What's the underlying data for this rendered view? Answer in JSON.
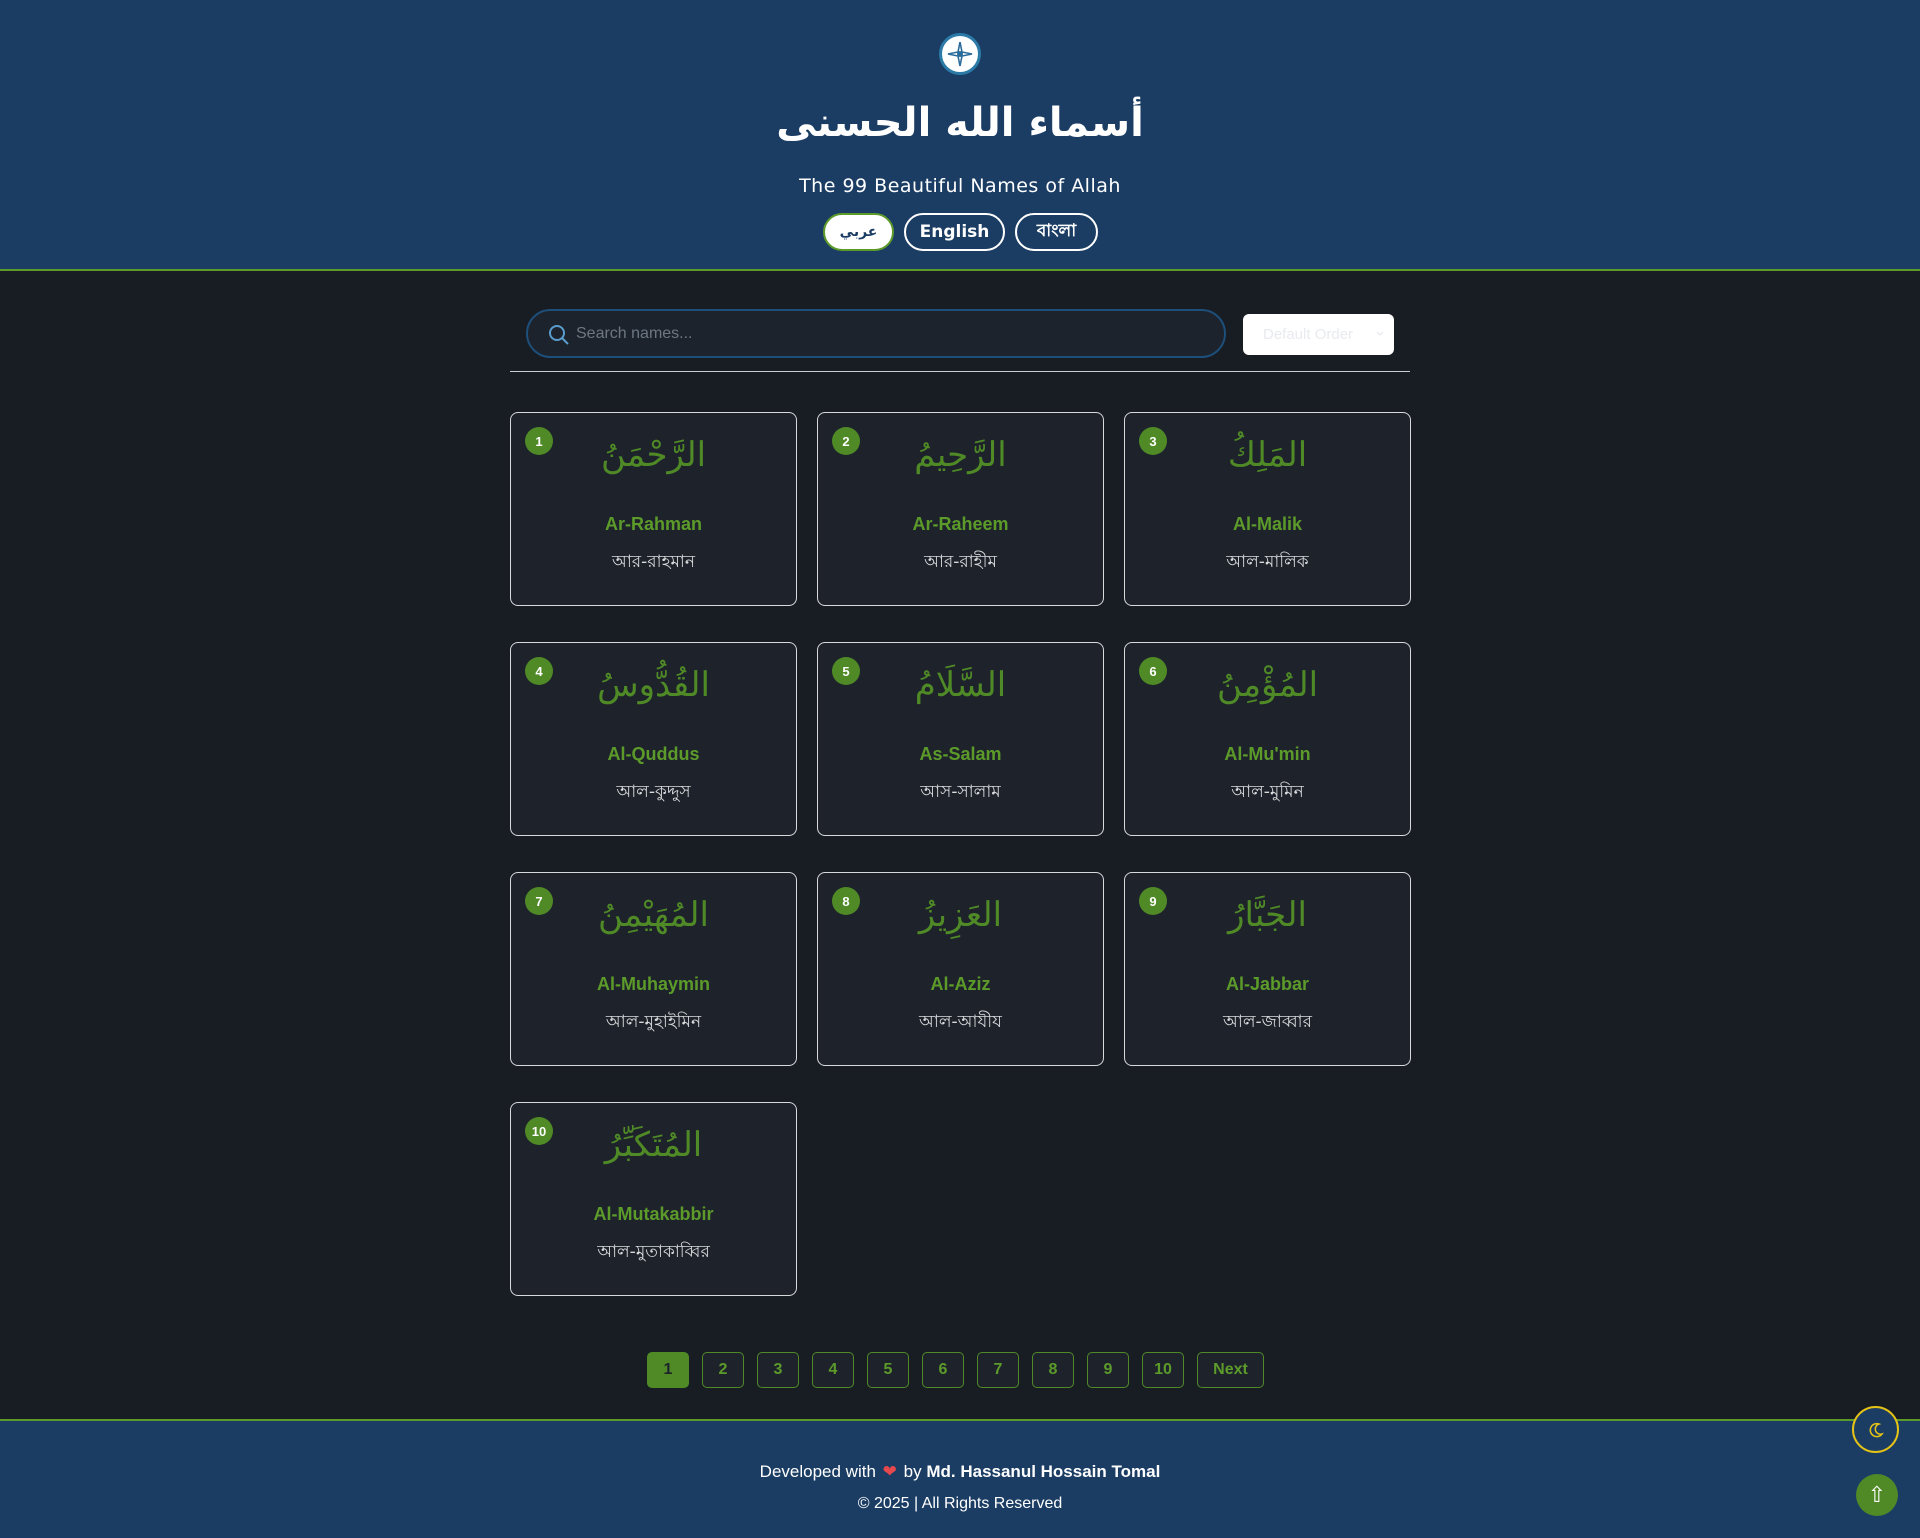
{
  "header": {
    "logo_icon": "compass-icon",
    "title": "أسماء الله الحسنى",
    "subtitle": "The 99 Beautiful Names of Allah",
    "languages": [
      {
        "label": "عربي",
        "active": true
      },
      {
        "label": "English",
        "active": false
      },
      {
        "label": "বাংলা",
        "active": false
      }
    ]
  },
  "toolbar": {
    "search_placeholder": "Search names...",
    "search_value": "",
    "order_selected": "Default Order"
  },
  "names": [
    {
      "number": "1",
      "arabic": "الرَّحْمَنُ",
      "transliteration": "Ar-Rahman",
      "bangla": "আর-রাহমান"
    },
    {
      "number": "2",
      "arabic": "الرَّحِيمُ",
      "transliteration": "Ar-Raheem",
      "bangla": "আর-রাহীম"
    },
    {
      "number": "3",
      "arabic": "المَلِكُ",
      "transliteration": "Al-Malik",
      "bangla": "আল-মালিক"
    },
    {
      "number": "4",
      "arabic": "القُدُّوسُ",
      "transliteration": "Al-Quddus",
      "bangla": "আল-কুদ্দুস"
    },
    {
      "number": "5",
      "arabic": "السَّلَامُ",
      "transliteration": "As-Salam",
      "bangla": "আস-সালাম"
    },
    {
      "number": "6",
      "arabic": "المُؤْمِنُ",
      "transliteration": "Al-Mu'min",
      "bangla": "আল-মুমিন"
    },
    {
      "number": "7",
      "arabic": "المُهَيْمِنُ",
      "transliteration": "Al-Muhaymin",
      "bangla": "আল-মুহাইমিন"
    },
    {
      "number": "8",
      "arabic": "العَزِيزُ",
      "transliteration": "Al-Aziz",
      "bangla": "আল-আযীয"
    },
    {
      "number": "9",
      "arabic": "الجَبَّارُ",
      "transliteration": "Al-Jabbar",
      "bangla": "আল-জাব্বার"
    },
    {
      "number": "10",
      "arabic": "المُتَكَبِّرُ",
      "transliteration": "Al-Mutakabbir",
      "bangla": "আল-মুতাকাব্বির"
    }
  ],
  "pagination": {
    "pages": [
      "1",
      "2",
      "3",
      "4",
      "5",
      "6",
      "7",
      "8",
      "9",
      "10"
    ],
    "current": "1",
    "next_label": "Next"
  },
  "footer": {
    "developed_with": "Developed with",
    "heart": "❤",
    "by": "by",
    "author": "Md. Hassanul Hossain Tomal",
    "copyright": "© 2025 | All Rights Reserved"
  },
  "floating": {
    "theme_toggle_icon": "moon-icon",
    "scroll_top_icon": "arrow-up-icon",
    "scroll_top_glyph": "⇧"
  },
  "colors": {
    "header_bg": "#1b3d63",
    "page_bg": "#181c23",
    "card_bg": "#1e232b",
    "accent_green": "#4f8a26",
    "theme_toggle_border": "#e5c316"
  }
}
